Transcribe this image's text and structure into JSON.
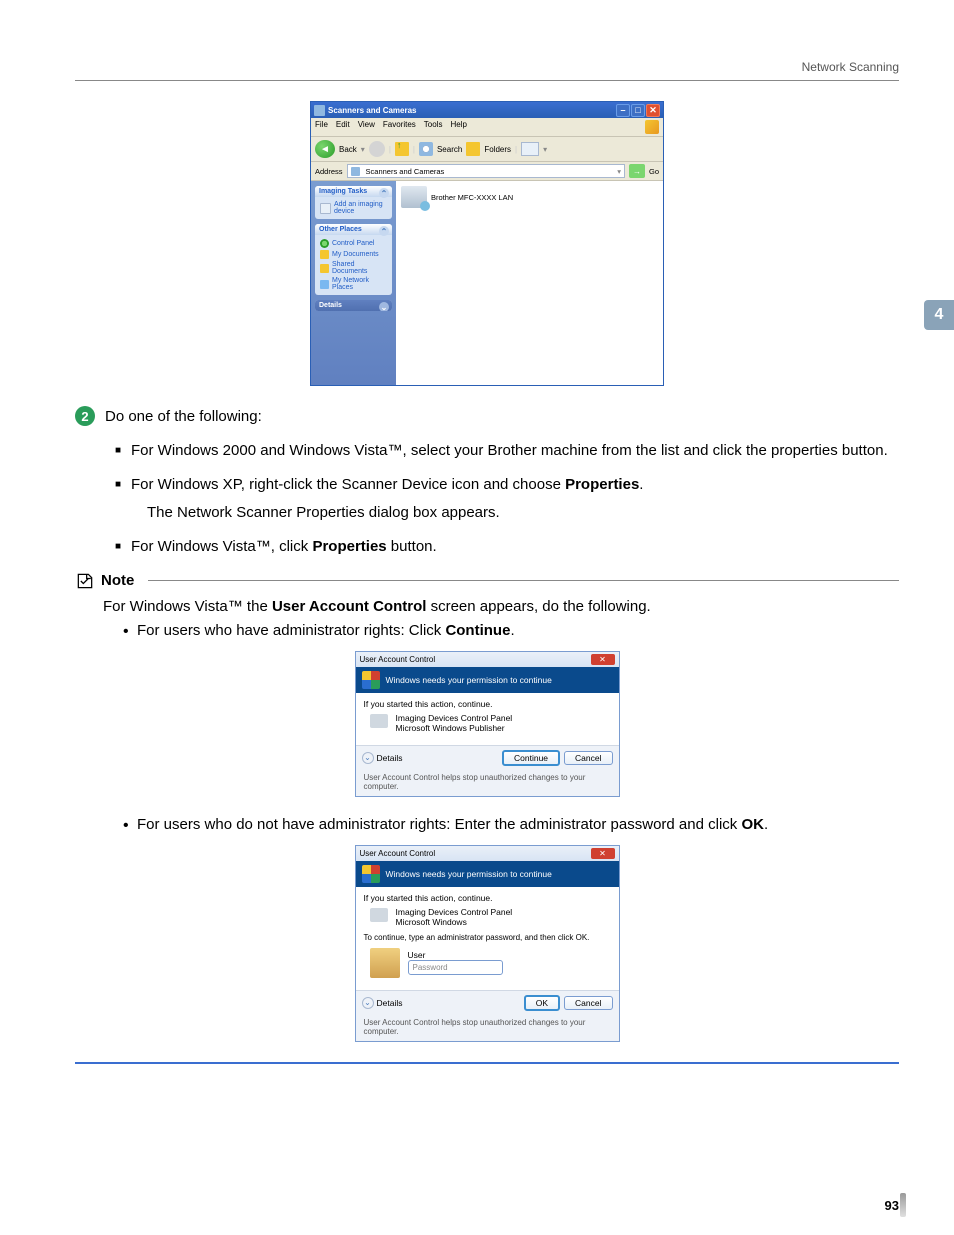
{
  "header": {
    "section": "Network Scanning"
  },
  "side_tab": "4",
  "page_number": "93",
  "explorer": {
    "title": "Scanners and Cameras",
    "menu": [
      "File",
      "Edit",
      "View",
      "Favorites",
      "Tools",
      "Help"
    ],
    "toolbar": {
      "back": "Back",
      "search": "Search",
      "folders": "Folders"
    },
    "address_label": "Address",
    "address_value": "Scanners and Cameras",
    "go": "Go",
    "panels": {
      "imaging_tasks": {
        "title": "Imaging Tasks",
        "items": [
          "Add an imaging device"
        ]
      },
      "other_places": {
        "title": "Other Places",
        "items": [
          "Control Panel",
          "My Documents",
          "Shared Documents",
          "My Network Places"
        ]
      },
      "details": {
        "title": "Details"
      }
    },
    "device": "Brother MFC-XXXX LAN"
  },
  "step2": {
    "num": "2",
    "lead": "Do one of the following:",
    "bullets": [
      {
        "pre": "For Windows 2000 and Windows Vista™, select your Brother machine from the list and click the properties button."
      },
      {
        "pre": "For Windows XP, right-click the Scanner Device icon and choose ",
        "bold": "Properties",
        "post": ".",
        "sub": "The Network Scanner Properties dialog box appears."
      },
      {
        "pre": "For Windows Vista™, click ",
        "bold": "Properties",
        "post": " button."
      }
    ]
  },
  "note": {
    "label": "Note",
    "lead_pre": "For Windows Vista™ the ",
    "lead_bold": "User Account Control",
    "lead_post": " screen appears, do the following.",
    "items": [
      {
        "pre": "For users who have administrator rights: Click ",
        "bold": "Continue",
        "post": "."
      },
      {
        "pre": "For users who do not have administrator rights: Enter the administrator password and click ",
        "bold": "OK",
        "post": "."
      }
    ]
  },
  "uac1": {
    "title": "User Account Control",
    "band": "Windows needs your permission to continue",
    "started": "If you started this action, continue.",
    "app_name": "Imaging Devices Control Panel",
    "app_pub": "Microsoft Windows Publisher",
    "details": "Details",
    "btn_continue": "Continue",
    "btn_cancel": "Cancel",
    "foot": "User Account Control helps stop unauthorized changes to your computer."
  },
  "uac2": {
    "title": "User Account Control",
    "band": "Windows needs your permission to continue",
    "started": "If you started this action, continue.",
    "app_name": "Imaging Devices Control Panel",
    "app_pub": "Microsoft Windows",
    "pwd_line": "To continue, type an administrator password, and then click OK.",
    "user": "User",
    "pwd_placeholder": "Password",
    "details": "Details",
    "btn_ok": "OK",
    "btn_cancel": "Cancel",
    "foot": "User Account Control helps stop unauthorized changes to your computer."
  }
}
